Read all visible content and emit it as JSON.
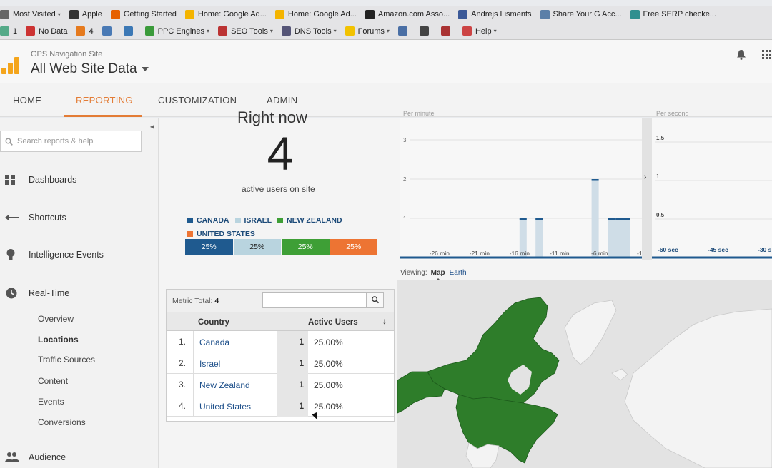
{
  "browser": {
    "bookmarks_row1": [
      {
        "label": "Most Visited",
        "icon": "gear-icon",
        "dropdown": true
      },
      {
        "label": "Apple",
        "icon": "apple-icon"
      },
      {
        "label": "Getting Started",
        "icon": "firefox-icon"
      },
      {
        "label": "Home: Google Ad...",
        "icon": "adwords-icon"
      },
      {
        "label": "Home: Google Ad...",
        "icon": "adwords-icon"
      },
      {
        "label": "Amazon.com Asso...",
        "icon": "amazon-icon"
      },
      {
        "label": "Andrejs Lisments",
        "icon": "facebook-icon"
      },
      {
        "label": "Share Your G Acc...",
        "icon": "wa-icon"
      },
      {
        "label": "Free SERP checke...",
        "icon": "plus-icon"
      }
    ],
    "bookmarks_row2": [
      {
        "label": "1",
        "icon": "seo-icon"
      },
      {
        "label": "No Data",
        "icon": "cross-icon"
      },
      {
        "label": "4",
        "icon": "pr-icon"
      },
      {
        "label": "",
        "icon": "chart-icon"
      },
      {
        "label": "",
        "icon": "m-icon"
      },
      {
        "label": "PPC Engines",
        "icon": "ppc-icon",
        "dropdown": true
      },
      {
        "label": "SEO Tools",
        "icon": "seo-tools-icon",
        "dropdown": true
      },
      {
        "label": "DNS Tools",
        "icon": "dns-icon",
        "dropdown": true
      },
      {
        "label": "Forums",
        "icon": "smiley-icon",
        "dropdown": true
      },
      {
        "label": "",
        "icon": "magnifier-icon"
      },
      {
        "label": "",
        "icon": "bug-icon"
      },
      {
        "label": "",
        "icon": "stats-icon"
      },
      {
        "label": "Help",
        "icon": "lifebuoy-icon",
        "dropdown": true
      }
    ]
  },
  "header": {
    "site_name": "GPS Navigation Site",
    "view_name": "All Web Site Data"
  },
  "nav_tabs": [
    {
      "label": "HOME",
      "active": false
    },
    {
      "label": "REPORTING",
      "active": true
    },
    {
      "label": "CUSTOMIZATION",
      "active": false
    },
    {
      "label": "ADMIN",
      "active": false
    }
  ],
  "sidebar": {
    "search_placeholder": "Search reports & help",
    "items": [
      {
        "label": "Dashboards",
        "icon": "grid-icon"
      },
      {
        "label": "Shortcuts",
        "icon": "shortcut-arrow-icon"
      },
      {
        "label": "Intelligence Events",
        "icon": "lightbulb-icon"
      },
      {
        "label": "Real-Time",
        "icon": "clock-icon"
      }
    ],
    "realtime_sub": [
      {
        "label": "Overview",
        "active": false
      },
      {
        "label": "Locations",
        "active": true
      },
      {
        "label": "Traffic Sources",
        "active": false
      },
      {
        "label": "Content",
        "active": false
      },
      {
        "label": "Events",
        "active": false
      },
      {
        "label": "Conversions",
        "active": false
      }
    ],
    "audience": {
      "label": "Audience",
      "icon": "people-icon"
    }
  },
  "realtime": {
    "title": "Right now",
    "active_users": "4",
    "active_users_label": "active users on site",
    "legend": [
      {
        "label": "CANADA",
        "color": "#1f5a8f"
      },
      {
        "label": "ISRAEL",
        "color": "#b9d4df"
      },
      {
        "label": "NEW ZEALAND",
        "color": "#3e9f36"
      },
      {
        "label": "UNITED STATES",
        "color": "#ed7433"
      }
    ],
    "shares": [
      {
        "label": "25%",
        "value": 25,
        "color": "#1f5a8f",
        "text_color": "#ffffff"
      },
      {
        "label": "25%",
        "value": 25,
        "color": "#b9d4df",
        "text_color": "#222222"
      },
      {
        "label": "25%",
        "value": 25,
        "color": "#3e9f36",
        "text_color": "#ffffff"
      },
      {
        "label": "25%",
        "value": 25,
        "color": "#ed7433",
        "text_color": "#ffffff"
      }
    ]
  },
  "table": {
    "metric_total_label": "Metric Total:",
    "metric_total_value": "4",
    "columns": [
      "Country",
      "Active Users"
    ],
    "rows": [
      {
        "index": "1.",
        "country": "Canada",
        "count": "1",
        "pct": "25.00%"
      },
      {
        "index": "2.",
        "country": "Israel",
        "count": "1",
        "pct": "25.00%"
      },
      {
        "index": "3.",
        "country": "New Zealand",
        "count": "1",
        "pct": "25.00%"
      },
      {
        "index": "4.",
        "country": "United States",
        "count": "1",
        "pct": "25.00%"
      }
    ]
  },
  "charts": {
    "per_minute_title": "Per minute",
    "per_second_title": "Per second",
    "per_minute": {
      "y_ticks": [
        "1",
        "2",
        "3"
      ],
      "x_ticks": [
        "-26 min",
        "-21 min",
        "-16 min",
        "-11 min",
        "-6 min",
        "-1"
      ],
      "bars": [
        {
          "minute": -16,
          "value": 1
        },
        {
          "minute": -14,
          "value": 1
        },
        {
          "minute": -7,
          "value": 2
        },
        {
          "minute": -5,
          "value": 1
        },
        {
          "minute": -4,
          "value": 1
        }
      ]
    },
    "per_second": {
      "y_ticks": [
        "0.5",
        "1",
        "1.5"
      ],
      "x_ticks": [
        "-60 sec",
        "-45 sec",
        "-30 s"
      ]
    }
  },
  "map": {
    "viewing_label": "Viewing:",
    "map_tab": "Map",
    "earth_tab": "Earth",
    "highlight_color": "#2e7d2a",
    "land_color": "#f3f3f3",
    "water_color": "#e3e3e3"
  }
}
